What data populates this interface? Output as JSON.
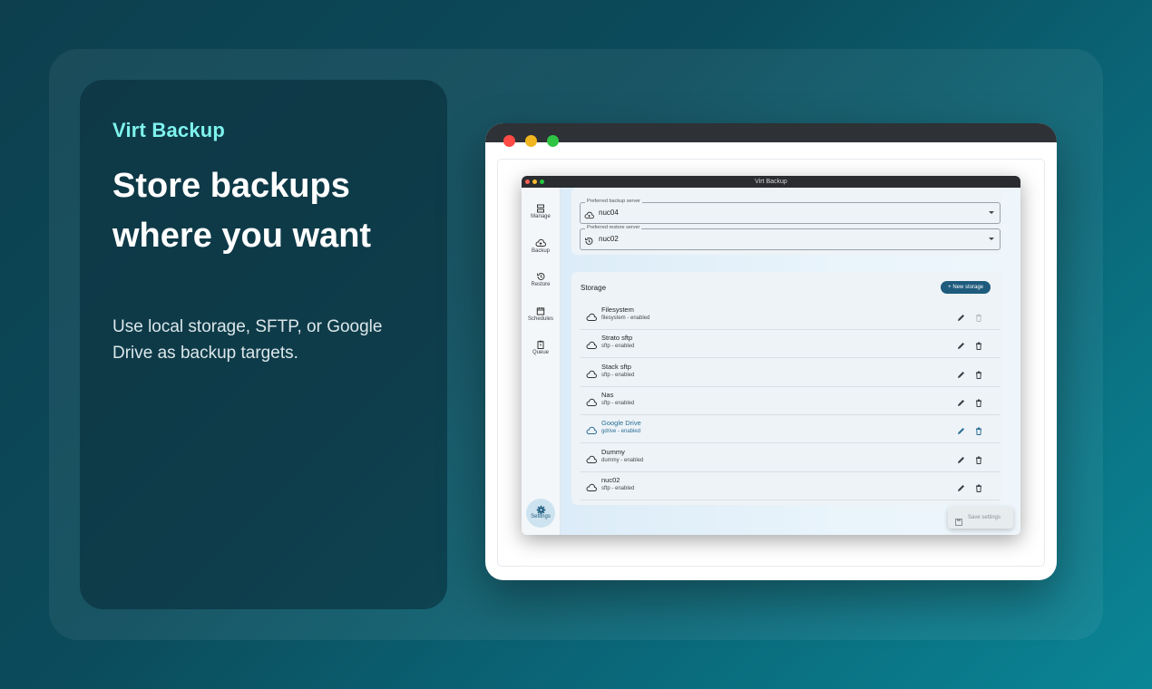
{
  "promo": {
    "brand": "Virt Backup",
    "headline": "Store backups where you want",
    "description": "Use local storage, SFTP, or Google Drive as backup targets."
  },
  "app": {
    "window_title": "Virt Backup",
    "nav": [
      {
        "label": "Manage",
        "icon": "server-icon"
      },
      {
        "label": "Backup",
        "icon": "cloud-upload-icon"
      },
      {
        "label": "Restore",
        "icon": "history-icon"
      },
      {
        "label": "Schedules",
        "icon": "calendar-icon"
      },
      {
        "label": "Queue",
        "icon": "clipboard-icon"
      },
      {
        "label": "Settings",
        "icon": "gear-icon",
        "active": true
      }
    ],
    "preferred_backup": {
      "label": "Preferred backup server",
      "value": "nuc04"
    },
    "preferred_restore": {
      "label": "Preferred restore server",
      "value": "nuc02"
    },
    "storage": {
      "title": "Storage",
      "new_button": "New storage",
      "items": [
        {
          "name": "Filesystem",
          "sub": "filesystem - enabled",
          "delete_disabled": true
        },
        {
          "name": "Strato sftp",
          "sub": "sftp - enabled"
        },
        {
          "name": "Stack sftp",
          "sub": "sftp - enabled"
        },
        {
          "name": "Nas",
          "sub": "sftp - enabled"
        },
        {
          "name": "Google Drive",
          "sub": "gdrive - enabled",
          "highlighted": true
        },
        {
          "name": "Dummy",
          "sub": "dummy - enabled"
        },
        {
          "name": "nuc02",
          "sub": "sftp - enabled"
        }
      ]
    },
    "save_button": "Save settings"
  },
  "colors": {
    "accent": "#1e5b7d",
    "brand": "#7ef3ee"
  }
}
